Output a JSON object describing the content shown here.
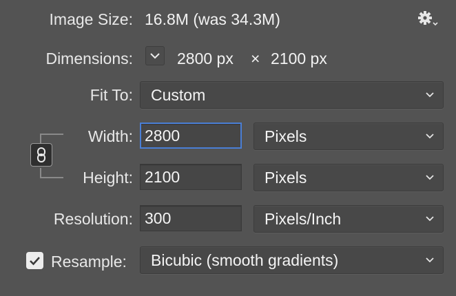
{
  "image_size": {
    "label": "Image Size:",
    "value": "16.8M (was 34.3M)"
  },
  "dimensions": {
    "label": "Dimensions:",
    "width": "2800 px",
    "times": "×",
    "height": "2100 px"
  },
  "fit_to": {
    "label": "Fit To:",
    "value": "Custom"
  },
  "width": {
    "label": "Width:",
    "value": "2800",
    "unit": "Pixels"
  },
  "height": {
    "label": "Height:",
    "value": "2100",
    "unit": "Pixels"
  },
  "resolution": {
    "label": "Resolution:",
    "value": "300",
    "unit": "Pixels/Inch"
  },
  "resample": {
    "label": "Resample:",
    "checked": true,
    "value": "Bicubic (smooth gradients)"
  },
  "icons": {
    "settings": "gear-icon",
    "dimensions_toggle": "chevron-down-icon",
    "constrain": "link-icon",
    "dropdown": "chevron-down-icon"
  },
  "colors": {
    "background": "#535353",
    "focus": "#4a7fd6",
    "field": "#464646"
  }
}
